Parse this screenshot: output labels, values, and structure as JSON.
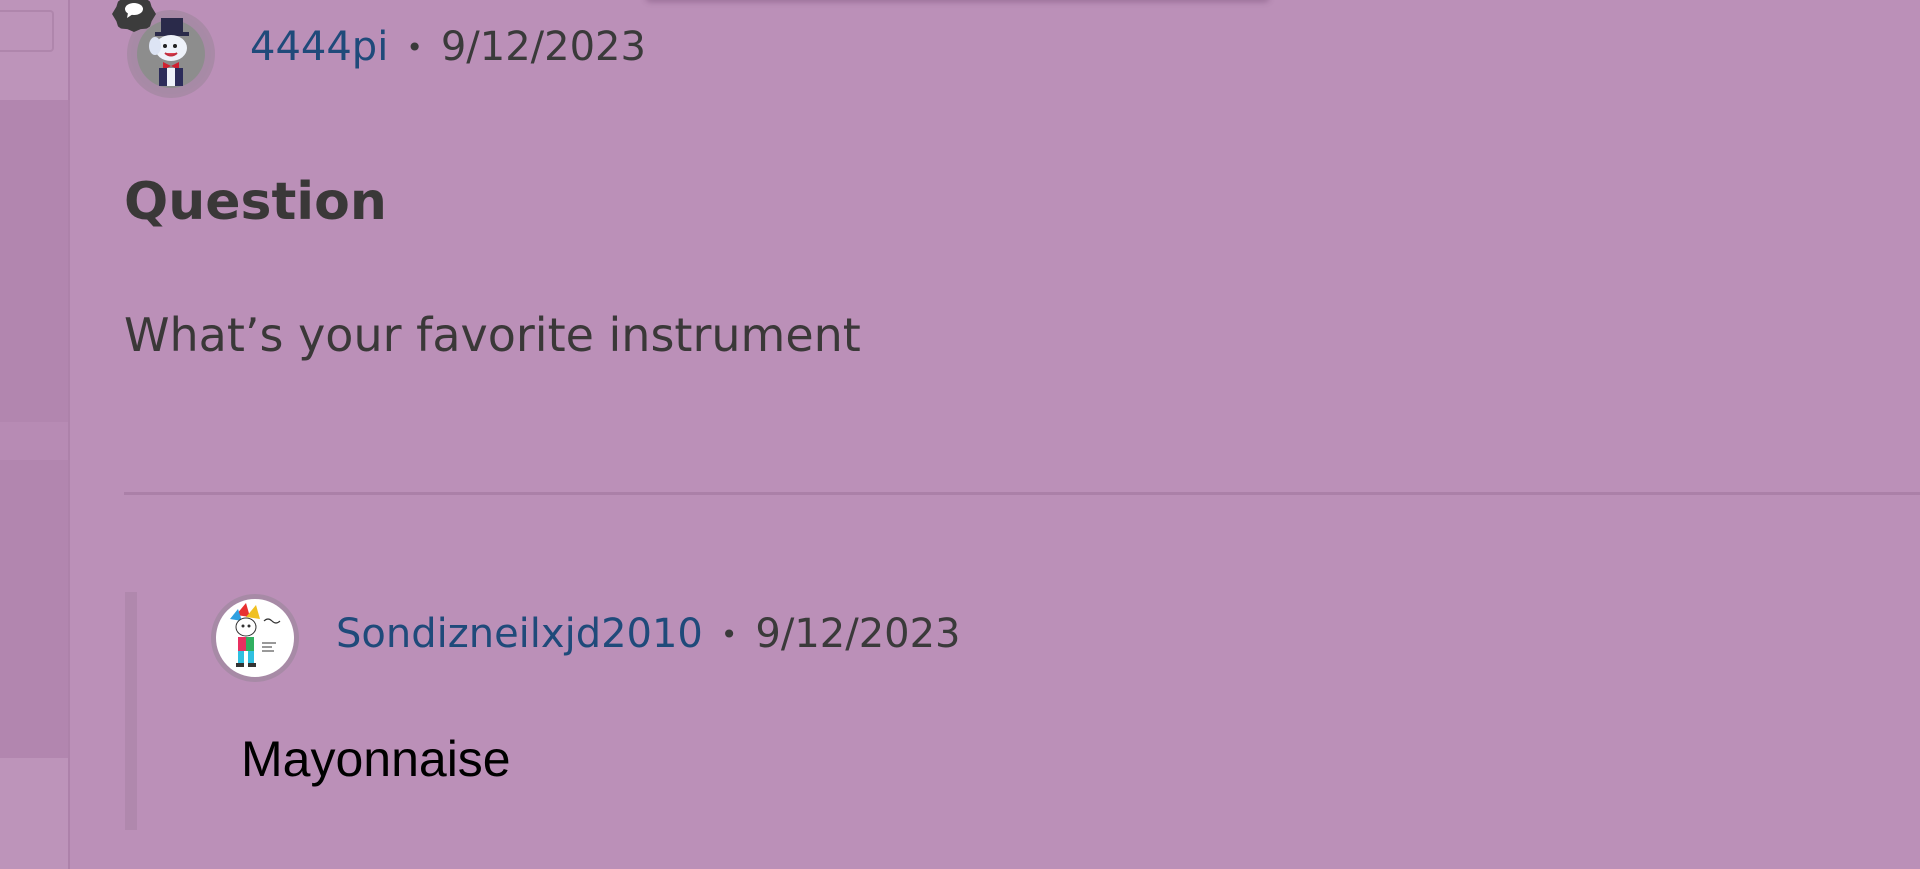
{
  "post": {
    "author": "4444pi",
    "separator": "•",
    "date": "9/12/2023",
    "title": "Question",
    "body": "What’s your favorite instrument"
  },
  "reply": {
    "author": "Sondizneilxjd2010",
    "separator": "•",
    "date": "9/12/2023",
    "body": "Mayonnaise"
  },
  "icons": {
    "post_badge": "comment-icon",
    "post_avatar": "cartoon-character-avatar",
    "reply_avatar": "jester-drawing-avatar"
  },
  "colors": {
    "background": "#bb90b8",
    "username": "#1f4a7a",
    "text": "#3a3838"
  }
}
